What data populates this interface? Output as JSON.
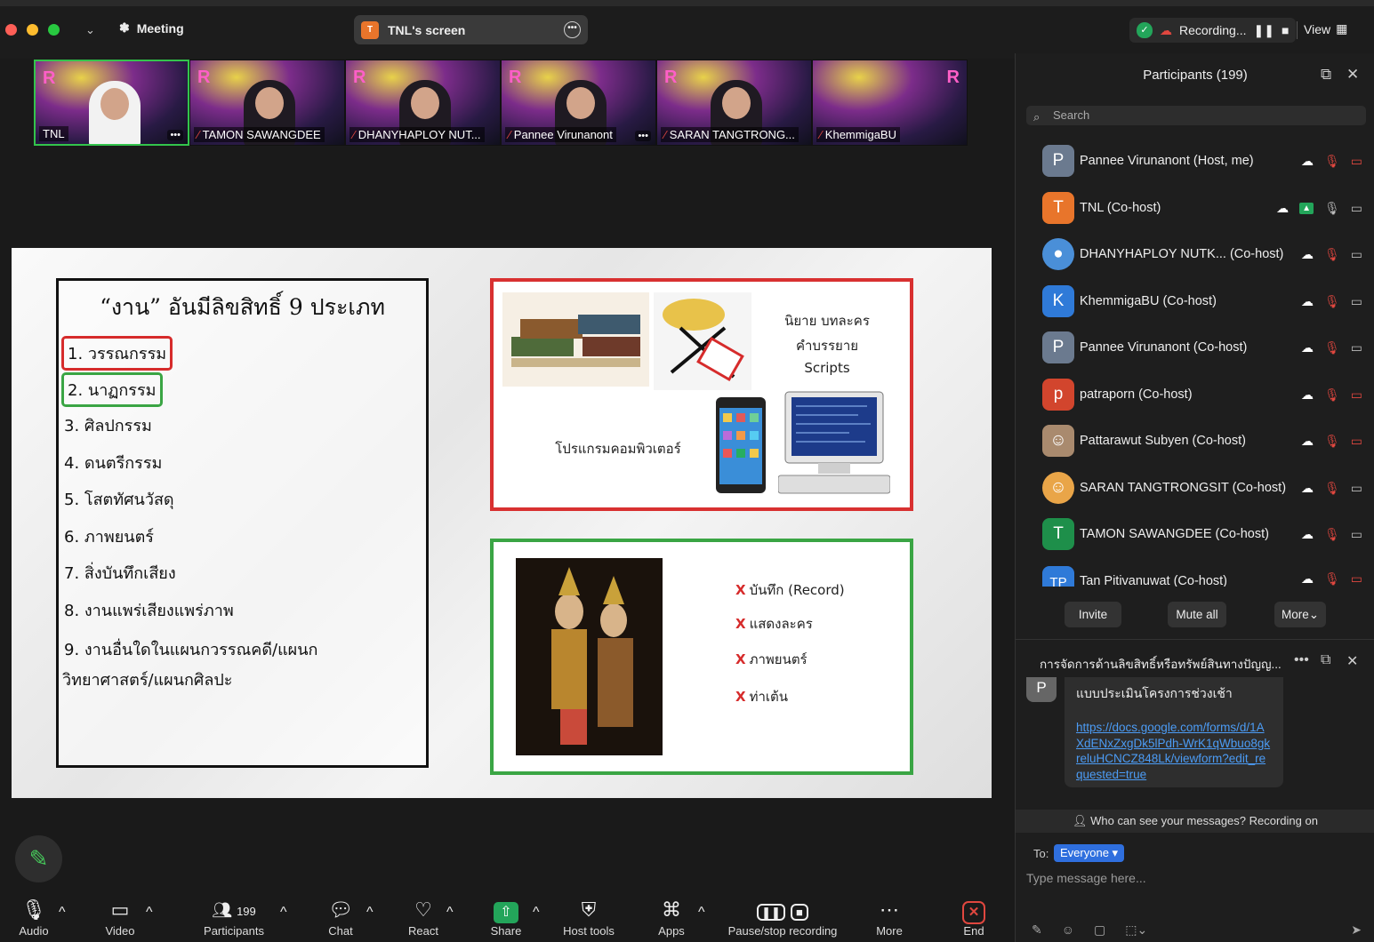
{
  "topbar": {
    "meeting_label": "Meeting",
    "screen_label": "TNL's screen",
    "screen_badge": "T",
    "recording_label": "Recording...",
    "view_label": "View"
  },
  "thumbnails": [
    {
      "name": "TNL"
    },
    {
      "name": "TAMON SAWANGDEE"
    },
    {
      "name": "DHANYHAPLOY NUT..."
    },
    {
      "name": "Pannee Virunanont"
    },
    {
      "name": "SARAN TANGTRONG..."
    },
    {
      "name": "KhemmigaBU"
    }
  ],
  "slide": {
    "title": "“งาน” อันมีลิขสิทธิ์ 9 ประเภท",
    "items": [
      "1. วรรณกรรม",
      "2. นาฏกรรม",
      "3. ศิลปกรรม",
      "4. ดนตรีกรรม",
      "5. โสตทัศนวัสดุ",
      "6. ภาพยนตร์",
      "7. สิ่งบันทึกเสียง",
      "8. งานแพร่เสียงแพร่ภาพ",
      "9. งานอื่นใดในแผนกวรรณคดี/แผนก",
      "วิทยาศาสตร์/แผนกศิลปะ"
    ],
    "red_box": {
      "line1": "นิยาย บทละคร",
      "line2": "คำบรรยาย",
      "line3": "Scripts",
      "program": "โปรแกรมคอมพิวเตอร์"
    },
    "green_box": {
      "items": [
        "บันทึก (Record)",
        "แสดงละคร",
        "ภาพยนตร์",
        "ท่าเต้น"
      ],
      "x_mark": "X"
    }
  },
  "participants": {
    "header": "Participants (199)",
    "search_placeholder": "Search",
    "list": [
      {
        "initial": "P",
        "name": "Pannee Virunanont (Host, me)",
        "color": "#6b7a8f"
      },
      {
        "initial": "T",
        "name": "TNL (Co-host)",
        "color": "#e8752b"
      },
      {
        "initial": "",
        "name": "DHANYHAPLOY NUTK...  (Co-host)",
        "color": "#4a8fd8"
      },
      {
        "initial": "K",
        "name": "KhemmigaBU (Co-host)",
        "color": "#2f7ad8"
      },
      {
        "initial": "P",
        "name": "Pannee Virunanont (Co-host)",
        "color": "#6b7a8f"
      },
      {
        "initial": "p",
        "name": "patraporn (Co-host)",
        "color": "#d2452d"
      },
      {
        "initial": "",
        "name": "Pattarawut Subyen (Co-host)",
        "color": "#a98a6e"
      },
      {
        "initial": "",
        "name": "SARAN TANGTRONGSIT  (Co-host)",
        "color": "#e9a548"
      },
      {
        "initial": "T",
        "name": "TAMON SAWANGDEE (Co-host)",
        "color": "#1e8f4a"
      },
      {
        "initial": "TP",
        "name": "Tan Pitivanuwat (Co-host)",
        "color": "#2f7ad8"
      }
    ],
    "invite": "Invite",
    "mute_all": "Mute all",
    "more": "More"
  },
  "chat": {
    "header": "การจัดการด้านลิขสิทธิ์หรือทรัพย์สินทางปัญญ...",
    "avatar": "P",
    "message_title": "แบบประเมินโครงการช่วงเช้า",
    "message_link": "https://docs.google.com/forms/d/1AXdENxZxgDk5lPdh-WrK1qWbuo8gkreluHCNCZ848Lk/viewform?edit_requested=true",
    "who_can_see": "Who can see your messages? Recording on",
    "to_label": "To:",
    "to_value": "Everyone",
    "placeholder": "Type message here..."
  },
  "toolbar": {
    "audio": "Audio",
    "video": "Video",
    "participants": "Participants",
    "participants_count": "199",
    "chat": "Chat",
    "react": "React",
    "share": "Share",
    "host_tools": "Host tools",
    "apps": "Apps",
    "pause_stop": "Pause/stop recording",
    "more": "More",
    "end": "End"
  }
}
